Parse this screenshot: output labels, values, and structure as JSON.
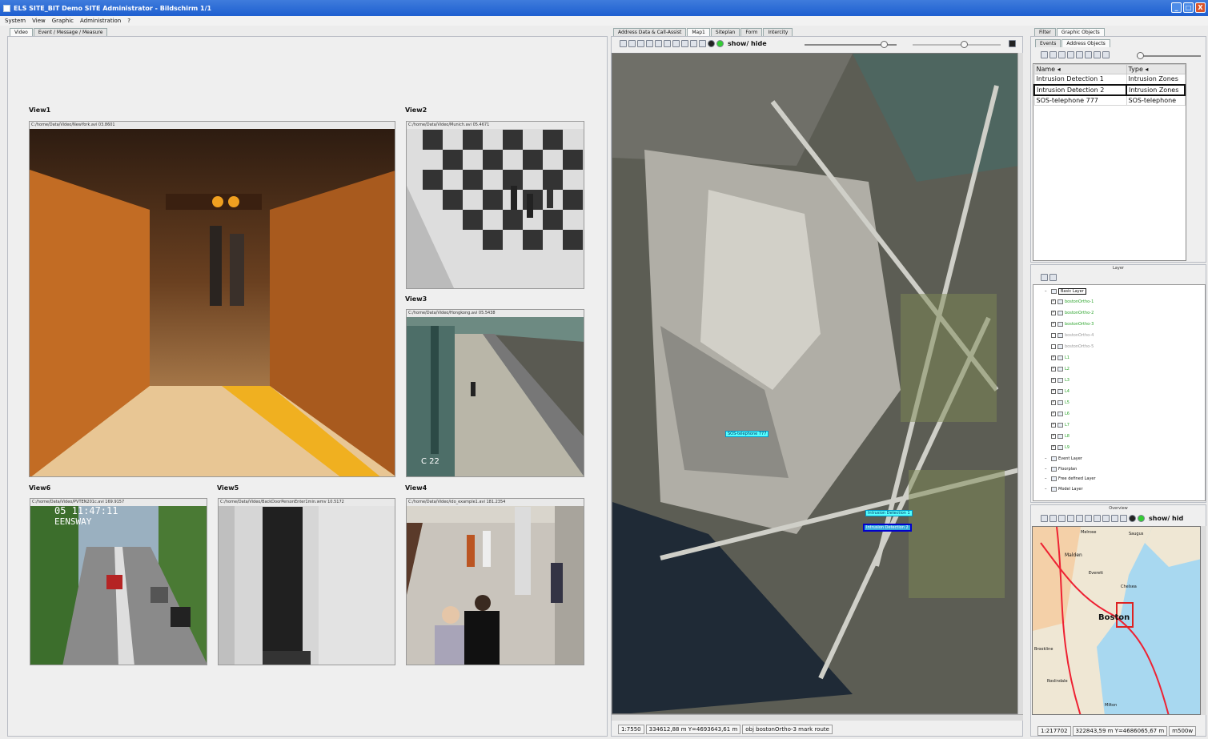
{
  "window": {
    "title": "ELS SITE_BIT Demo SITE Administrator - Bildschirm 1/1",
    "controls": {
      "minimize": "_",
      "maximize": "□",
      "close": "X"
    }
  },
  "menu": [
    "System",
    "View",
    "Graphic",
    "Administration",
    "?"
  ],
  "left_tabs": [
    {
      "label": "Video",
      "active": true
    },
    {
      "label": "Event / Message / Measure",
      "active": false
    }
  ],
  "views": [
    {
      "id": "view1",
      "label": "View1",
      "path": "C:/home/Data/Video/NewYork.avi 03.8601"
    },
    {
      "id": "view2",
      "label": "View2",
      "path": "C:/home/Data/Video/Munich.avi 05.4671"
    },
    {
      "id": "view3",
      "label": "View3",
      "path": "C:/home/Data/Video/Hongkong.avi 05.5438"
    },
    {
      "id": "view6",
      "label": "View6",
      "path": "C:/home/Data/Video/PVTEN201c.avi 169.9157",
      "overlay1": "05 11:47:11",
      "overlay2": "EENSWAY"
    },
    {
      "id": "view5",
      "label": "View5",
      "path": "C:/home/Data/Video/BackDoorPersonEnter1min.wmv 10.5172"
    },
    {
      "id": "view4",
      "label": "View4",
      "path": "C:/home/Data/Video/ido_example1.avi 181.2354"
    }
  ],
  "view3_overlay": "C 22",
  "center_tabs": [
    {
      "label": "Address Data & Call-Assist",
      "active": false
    },
    {
      "label": "Map1",
      "active": true
    },
    {
      "label": "Siteplan",
      "active": false
    },
    {
      "label": "Form",
      "active": false
    },
    {
      "label": "Intercity",
      "active": false
    }
  ],
  "map_toolbar": {
    "show_hide": "show/ hide"
  },
  "map_labels": {
    "sos": "SOS-telephone 777",
    "intrusion1": "Intrusion Detection 1",
    "intrusion2": "Intrusion Detection 2"
  },
  "map_status": [
    "1:7550",
    "334612,88 m Y=4693643,61 m",
    "obj bostonOrtho-3 mark route"
  ],
  "right_tabs_top": [
    {
      "label": "Filter",
      "active": false
    },
    {
      "label": "Graphic Objects",
      "active": true
    }
  ],
  "right_tabs_sub": [
    {
      "label": "Events",
      "active": false
    },
    {
      "label": "Address Objects",
      "active": true
    }
  ],
  "objects_table": {
    "columns": [
      "Name ◂",
      "Type ◂"
    ],
    "rows": [
      {
        "name": "Intrusion Detection 1",
        "type": "Intrusion Zones",
        "selected": false
      },
      {
        "name": "Intrusion Detection 2",
        "type": "Intrusion Zones",
        "selected": true
      },
      {
        "name": "SOS-telephone 777",
        "type": "SOS-telephone",
        "selected": false
      }
    ]
  },
  "layer_header": "Layer",
  "layer_tree": [
    {
      "label": "Basic Layer",
      "level": 1,
      "checked": false,
      "color": "#111111",
      "boxed": true
    },
    {
      "label": "bostonOrtho-1",
      "level": 2,
      "checked": true,
      "color": "#2aa32a"
    },
    {
      "label": "bostonOrtho-2",
      "level": 2,
      "checked": true,
      "color": "#2aa32a"
    },
    {
      "label": "bostonOrtho-3",
      "level": 2,
      "checked": true,
      "color": "#2aa32a"
    },
    {
      "label": "bostonOrtho-4",
      "level": 2,
      "checked": false,
      "color": "#9a9a9a"
    },
    {
      "label": "bostonOrtho-5",
      "level": 2,
      "checked": false,
      "color": "#9a9a9a"
    },
    {
      "label": "L1",
      "level": 2,
      "checked": true,
      "color": "#2aa32a"
    },
    {
      "label": "L2",
      "level": 2,
      "checked": true,
      "color": "#2aa32a"
    },
    {
      "label": "L3",
      "level": 2,
      "checked": true,
      "color": "#2aa32a"
    },
    {
      "label": "L4",
      "level": 2,
      "checked": true,
      "color": "#2aa32a"
    },
    {
      "label": "L5",
      "level": 2,
      "checked": true,
      "color": "#2aa32a"
    },
    {
      "label": "L6",
      "level": 2,
      "checked": true,
      "color": "#2aa32a"
    },
    {
      "label": "L7",
      "level": 2,
      "checked": true,
      "color": "#2aa32a"
    },
    {
      "label": "L8",
      "level": 2,
      "checked": true,
      "color": "#2aa32a"
    },
    {
      "label": "L9",
      "level": 2,
      "checked": true,
      "color": "#2aa32a"
    },
    {
      "label": "Event Layer",
      "level": 1,
      "checked": false,
      "color": "#111111"
    },
    {
      "label": "Floorplan",
      "level": 1,
      "checked": false,
      "color": "#111111"
    },
    {
      "label": "Free defined Layer",
      "level": 1,
      "checked": false,
      "color": "#111111"
    },
    {
      "label": "Model Layer",
      "level": 1,
      "checked": false,
      "color": "#111111"
    }
  ],
  "overview_header": "Overview",
  "overview_toolbar": {
    "show_hide": "show/ hid"
  },
  "overview_labels": [
    "Malden",
    "Everett",
    "Chelsea",
    "Boston",
    "Brookline",
    "Roslindale",
    "Milton",
    "Melrose",
    "Saugus"
  ],
  "overview_status": [
    "1:217702",
    "322843,59 m Y=4686065,67 m",
    "m500w"
  ]
}
